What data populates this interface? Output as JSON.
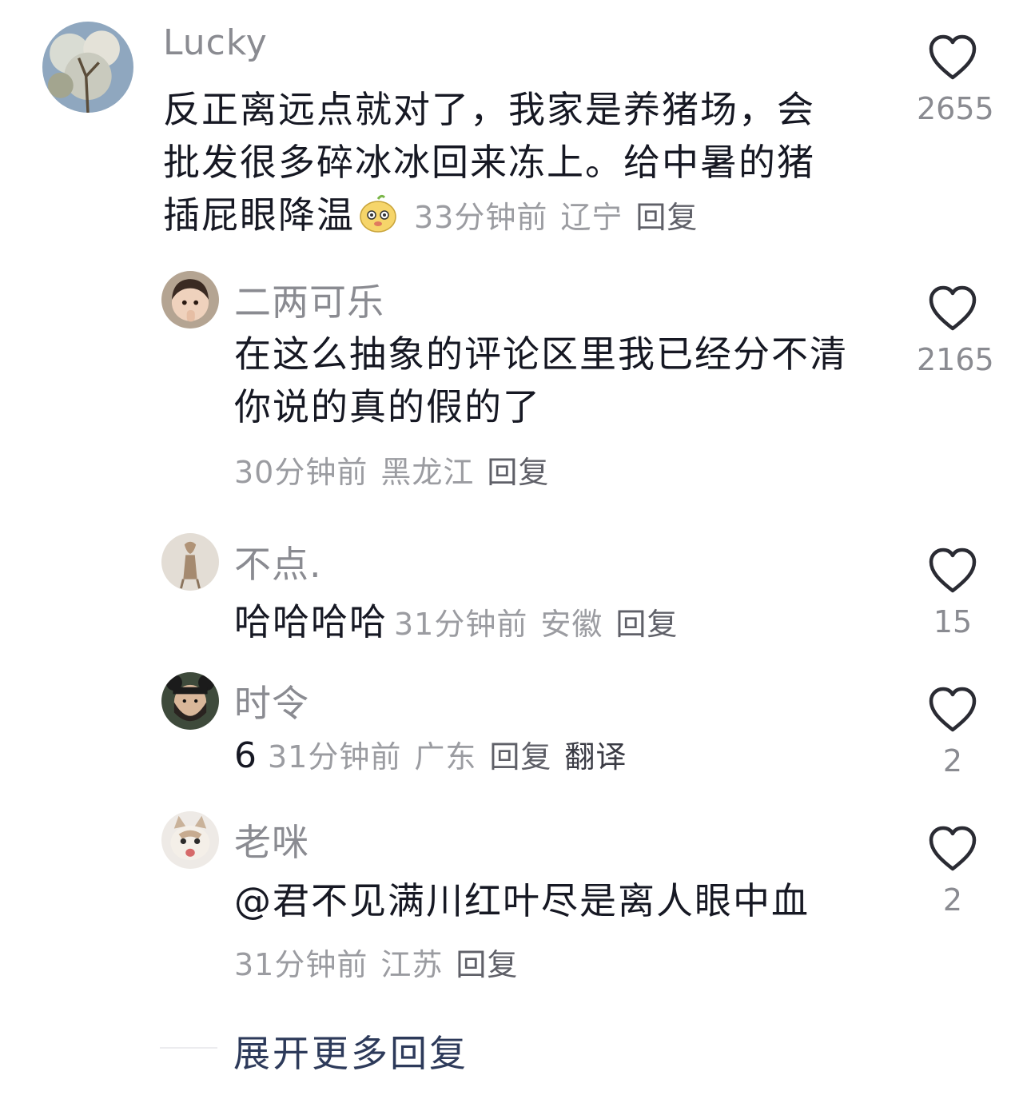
{
  "comments": [
    {
      "user": "Lucky",
      "text": "反正离远点就对了，我家是养猪场，会批发很多碎冰冰回来冻上。给中暑的猪插屁眼降温",
      "emoji": "dog-face-emoji",
      "time": "33分钟前",
      "location": "辽宁",
      "reply": "回复",
      "likes": "2655"
    },
    {
      "user": "二两可乐",
      "text": "在这么抽象的评论区里我已经分不清你说的真的假的了",
      "time": "30分钟前",
      "location": "黑龙江",
      "reply": "回复",
      "likes": "2165"
    },
    {
      "user": "不点.",
      "text": "哈哈哈哈",
      "time": "31分钟前",
      "location": "安徽",
      "reply": "回复",
      "likes": "15"
    },
    {
      "user": "时令",
      "text": "6",
      "time": "31分钟前",
      "location": "广东",
      "reply": "回复",
      "translate": "翻译",
      "likes": "2"
    },
    {
      "user": "老咪",
      "text": "@君不见满川红叶尽是离人眼中血",
      "time": "31分钟前",
      "location": "江苏",
      "reply": "回复",
      "likes": "2"
    }
  ],
  "expand_label": "展开更多回复",
  "icons": {
    "like": "heart-outline-icon"
  },
  "colors": {
    "name": "#8a8b91",
    "meta": "#9b9ca1",
    "text": "#161823",
    "expand": "#2d3a5a"
  }
}
